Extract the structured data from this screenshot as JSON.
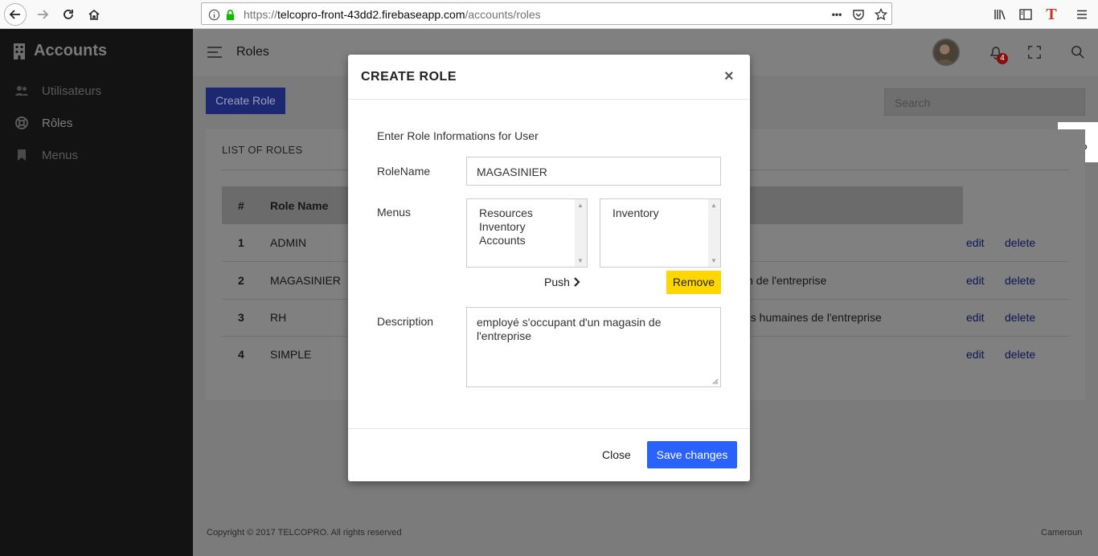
{
  "browser": {
    "url_scheme": "https://",
    "url_host": "telcopro-front-43dd2.firebaseapp.com",
    "url_path": "/accounts/roles",
    "more_glyph": "•••"
  },
  "sidebar": {
    "title": "Accounts",
    "items": [
      {
        "label": "Utilisateurs",
        "icon": "users-icon"
      },
      {
        "label": "Rôles",
        "icon": "lifebuoy-icon"
      },
      {
        "label": "Menus",
        "icon": "bookmark-icon"
      }
    ]
  },
  "topbar": {
    "title": "Roles",
    "notification_count": "4"
  },
  "toolbar": {
    "create_role_label": "Create Role",
    "search_placeholder": "Search"
  },
  "roles_card": {
    "title": "LIST OF ROLES",
    "headers": [
      "#",
      "Role Name"
    ],
    "rows": [
      {
        "num": "1",
        "name": "ADMIN",
        "desc": "",
        "edit": "edit",
        "delete": "delete"
      },
      {
        "num": "2",
        "name": "MAGASINIER",
        "desc": "in de l'entreprise",
        "edit": "edit",
        "delete": "delete"
      },
      {
        "num": "3",
        "name": "RH",
        "desc": "es humaines de l'entreprise",
        "edit": "edit",
        "delete": "delete"
      },
      {
        "num": "4",
        "name": "SIMPLE",
        "desc": "",
        "edit": "edit",
        "delete": "delete"
      }
    ]
  },
  "footer": {
    "copyright": "Copyright © 2017 TELCOPRO. All rights reserved",
    "country": "Cameroun"
  },
  "modal": {
    "title": "CREATE ROLE",
    "close_glyph": "×",
    "intro": "Enter Role Informations for User",
    "role_name_label": "RoleName",
    "role_name_value": "MAGASINIER",
    "menus_label": "Menus",
    "available_menus": [
      "Resources",
      "Inventory",
      "Accounts"
    ],
    "selected_menus": [
      "Inventory"
    ],
    "push_label": "Push",
    "remove_label": "Remove",
    "description_label": "Description",
    "description_value": "employé s'occupant d'un magasin de l'entreprise",
    "close_label": "Close",
    "save_label": "Save changes"
  },
  "colors": {
    "sidebar_bg": "#131313",
    "overlay_bg": "#7b7b7b",
    "primary": "#2962ff",
    "warning": "#ffd600",
    "badge": "#8a0d0d"
  }
}
